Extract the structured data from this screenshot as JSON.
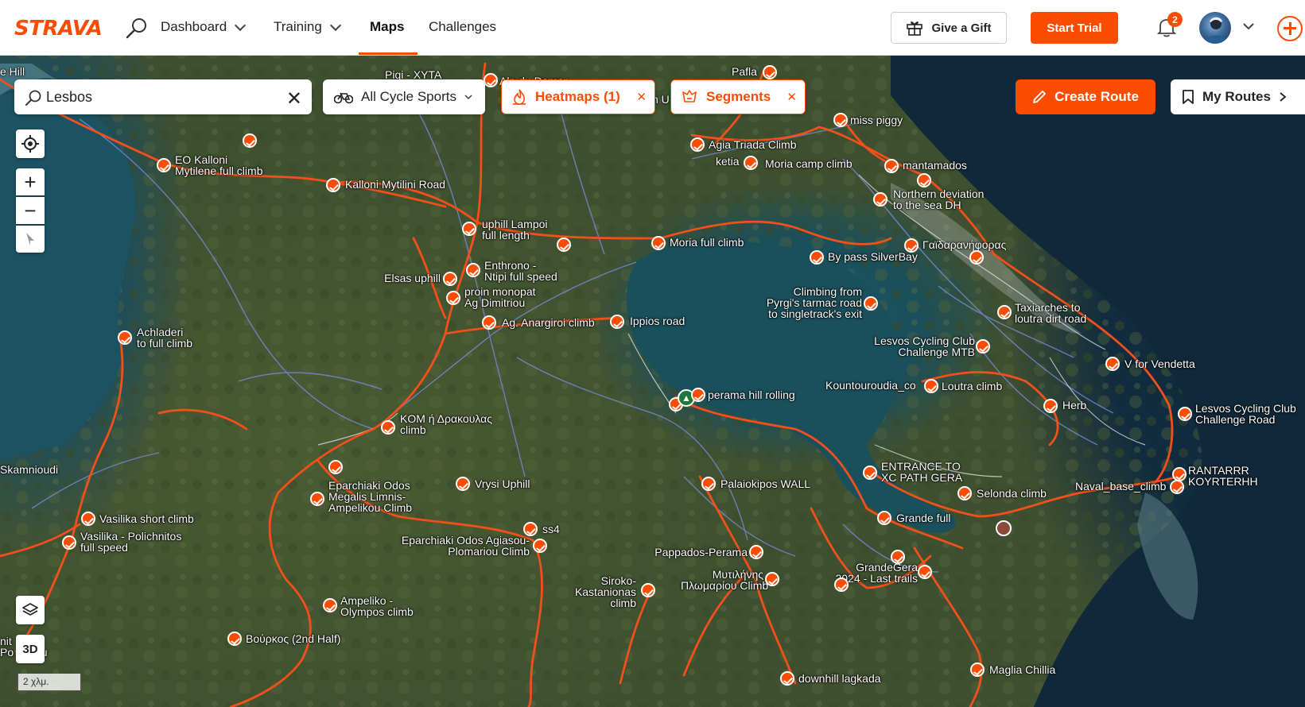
{
  "brand": {
    "logo": "STRAVA",
    "accent": "#fc4c02"
  },
  "nav": {
    "items": [
      {
        "label": "Dashboard",
        "has_menu": true
      },
      {
        "label": "Training",
        "has_menu": true
      },
      {
        "label": "Maps",
        "active": true
      },
      {
        "label": "Challenges"
      }
    ],
    "gift_label": "Give a Gift",
    "trial_label": "Start Trial",
    "notifications_count": "2"
  },
  "toolbar": {
    "search_value": "Lesbos",
    "sports_label": "All Cycle Sports",
    "heatmaps_label": "Heatmaps (1)",
    "segments_label": "Segments",
    "create_route_label": "Create Route",
    "my_routes_label": "My Routes"
  },
  "map_controls": {
    "btn_3d": "3D",
    "scale": "2 χλμ."
  },
  "segments": [
    "Pigi - XYTA",
    "Alp du Damar",
    "Pafla",
    "miss piggy",
    "EO Kalloni\nMytilene full climb",
    "Kalloni Mytilini Road",
    "Agia Triada Climb",
    "ketia",
    "Moria camp climb",
    "mantamados",
    "Northern deviation\nto the sea DH",
    "uphill Lampoi\nfull length",
    "Moria full climb",
    "Γαϊδαρανήφορας",
    "By pass SilverBay",
    "Enthrono -\nNtipi full speed",
    "Elsas uphill",
    "proin monopat\nAg Dimitriou",
    "Climbing from\nPyrgi's tarmac road\nto singletrack's exit",
    "Taxiarches to\nloutra dirt road",
    "Ag. Anargiroi climb",
    "Ippios road",
    "Achladeri\nto full climb",
    "Lesvos Cycling Club\nChallenge MTB",
    "V for Vendetta",
    "Kountouroudia_co",
    "Loutra climb",
    "perama hill rolling",
    "Herb",
    "Lesvos Cycling Club\nChallenge Road",
    "KOM ή Δρακουλας\nclimb",
    "ENTRANCE TO\nXC PATH GERA",
    "RANTARRR\nKOYRTERHH",
    "Eparchiaki Odos\nMegalis Limnis-\nAmpelikou Climb",
    "Vrysi Uphill",
    "Palaiokipos WALL",
    "Selonda climb",
    "Naval_base_climb",
    "Vasilika short climb",
    "Grande full",
    "ss4",
    "Vasilika - Polichnitos\nfull speed",
    "Eparchiaki Odos Agiasou-\nPlomariou Climb",
    "Pappados-Perama",
    "GrandeGera\n2024 - Last trails",
    "Μυτιλήνης\nΠλωμαρίου Climb",
    "Siroko-\nKastanionas\nclimb",
    "Ampeliko -\nOlympos climb",
    "Βούρκος (2nd Half)",
    "downhill lagkada",
    "Maglia Chillia",
    "e Hill",
    "Skamnioudi",
    "n U",
    "nit\nPo",
    "ou"
  ]
}
